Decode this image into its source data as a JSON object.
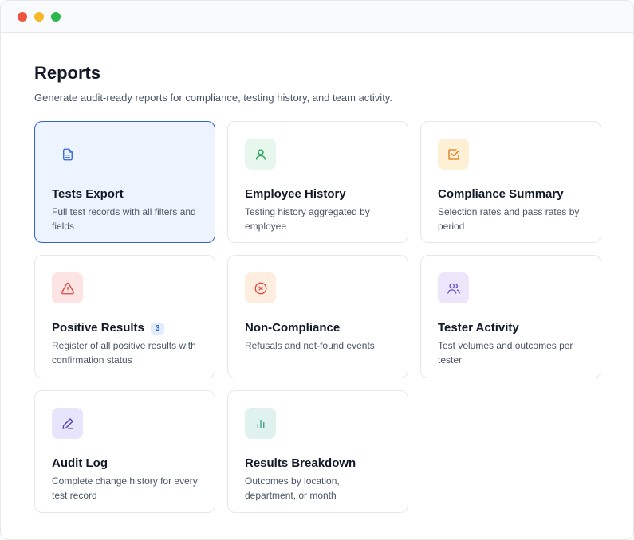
{
  "page": {
    "title": "Reports",
    "subtitle": "Generate audit-ready reports for compliance, testing history, and team activity."
  },
  "reports": [
    {
      "title": "Tests Export",
      "description": "Full test records with all filters and fields",
      "icon": "document-icon",
      "color": "#2f64d8",
      "bg": "transparent",
      "active": true
    },
    {
      "title": "Employee History",
      "description": "Testing history aggregated by employee",
      "icon": "user-icon",
      "color": "#1f9d55",
      "bg": "#e8f7ee"
    },
    {
      "title": "Compliance Summary",
      "description": "Selection rates and pass rates by period",
      "icon": "checkbox-icon",
      "color": "#e07b1a",
      "bg": "#fdf0d5"
    },
    {
      "title": "Positive Results",
      "badge": "3",
      "description": "Register of all positive results with confirmation status",
      "icon": "warning-icon",
      "color": "#e0473f",
      "bg": "#fde4e4"
    },
    {
      "title": "Non-Compliance",
      "description": "Refusals and not-found events",
      "icon": "x-circle-icon",
      "color": "#e0473f",
      "bg": "#fdeee0"
    },
    {
      "title": "Tester Activity",
      "description": "Test volumes and outcomes per tester",
      "icon": "users-icon",
      "color": "#6b4fc9",
      "bg": "#ece6fb"
    },
    {
      "title": "Audit Log",
      "description": "Complete change history for every test record",
      "icon": "pen-icon",
      "color": "#4b3fb8",
      "bg": "#e7e5fb"
    },
    {
      "title": "Results Breakdown",
      "description": "Outcomes by location, department, or month",
      "icon": "bar-chart-icon",
      "color": "#3f9c8a",
      "bg": "#e0f2ee"
    }
  ]
}
